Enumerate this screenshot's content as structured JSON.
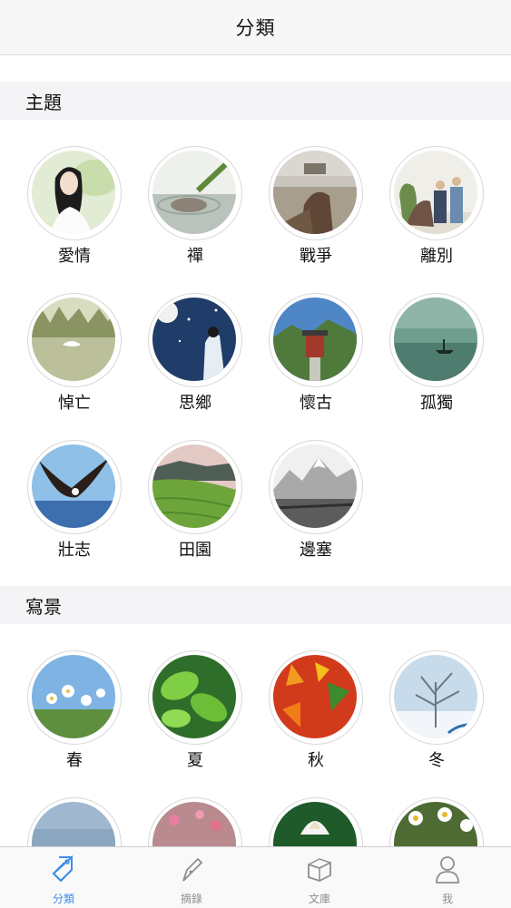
{
  "navbar": {
    "title": "分類"
  },
  "sections": [
    {
      "title": "主題",
      "items": [
        "愛情",
        "禪",
        "戰爭",
        "離別",
        "悼亡",
        "思鄉",
        "懷古",
        "孤獨",
        "壯志",
        "田園",
        "邊塞"
      ]
    },
    {
      "title": "寫景",
      "items": [
        "春",
        "夏",
        "秋",
        "冬"
      ]
    }
  ],
  "tabbar": {
    "tabs": [
      {
        "label": "分類",
        "icon": "tag-icon",
        "active": true
      },
      {
        "label": "摘錄",
        "icon": "pen-icon",
        "active": false
      },
      {
        "label": "文庫",
        "icon": "books-icon",
        "active": false
      },
      {
        "label": "我",
        "icon": "person-icon",
        "active": false
      }
    ]
  },
  "colors": {
    "accent": "#3d8ee8",
    "inactive": "#8e8e93",
    "section_bg": "#f4f4f6"
  }
}
